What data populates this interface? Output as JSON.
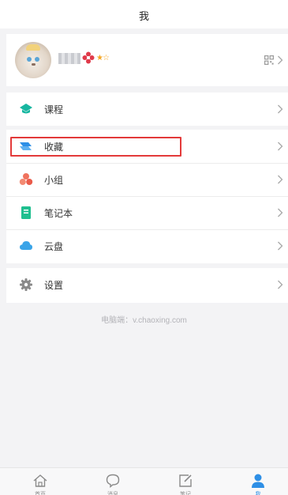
{
  "header": {
    "title": "我"
  },
  "profile": {
    "stars": "★☆"
  },
  "menu": {
    "courses": "课程",
    "favorites": "收藏",
    "groups": "小组",
    "notebook": "笔记本",
    "cloud": "云盘",
    "settings": "设置"
  },
  "footer_hint": "电脑端：v.chaoxing.com",
  "tabs": [
    {
      "label": "首页",
      "icon": "home-icon"
    },
    {
      "label": "消息",
      "icon": "chat-icon"
    },
    {
      "label": "笔记",
      "icon": "note-icon"
    },
    {
      "label": "我",
      "icon": "person-icon"
    }
  ],
  "colors": {
    "accent": "#2e8fe6",
    "courses_icon": "#17b6a0",
    "favorites_icon": "#2e8fe6",
    "groups_icon": "#f0735e",
    "notebook_icon": "#1fbf8f",
    "cloud_icon": "#3aa4e8",
    "settings_icon": "#8a8a8a",
    "highlight": "#e33a3a"
  }
}
